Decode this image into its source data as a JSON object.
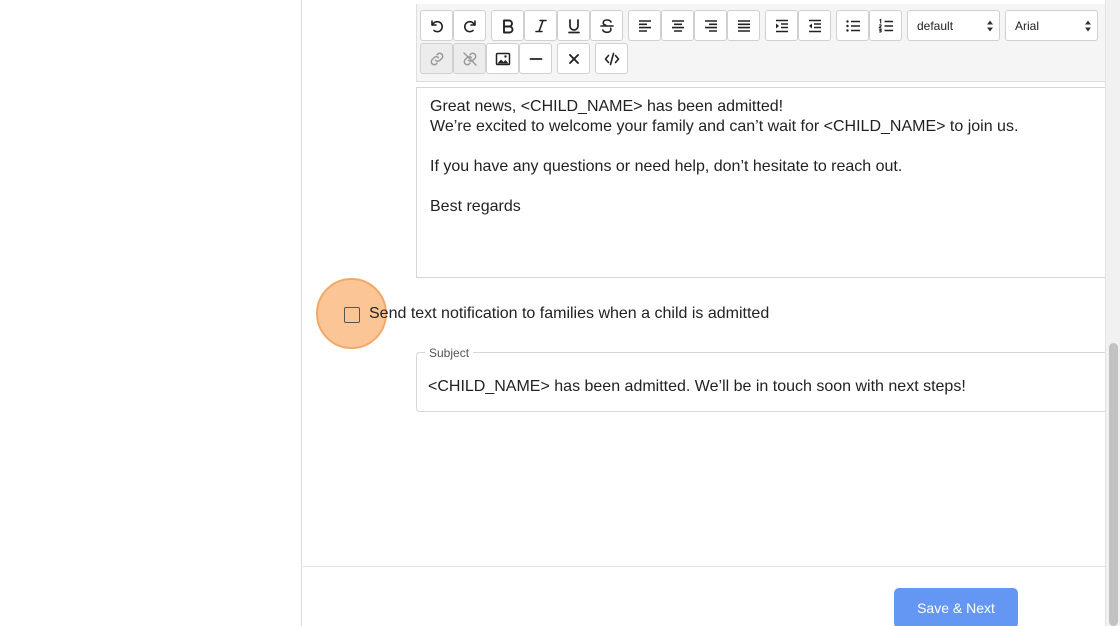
{
  "toolbar": {
    "paragraph_style": "default",
    "font_family": "Arial",
    "icons": [
      "undo-icon",
      "redo-icon",
      "bold-icon",
      "italic-icon",
      "underline-icon",
      "strikethrough-icon",
      "align-left-icon",
      "align-center-icon",
      "align-right-icon",
      "align-justify-icon",
      "indent-icon",
      "outdent-icon",
      "bullet-list-icon",
      "numbered-list-icon",
      "link-icon",
      "unlink-icon",
      "image-icon",
      "horizontal-rule-icon",
      "clear-format-icon",
      "code-view-icon"
    ]
  },
  "editor": {
    "lines": [
      "Great news, <CHILD_NAME> has been admitted!",
      "We’re excited to welcome your family and can’t wait for <CHILD_NAME> to join us.",
      "",
      "If you have any questions or need help, don’t hesitate to reach out.",
      "",
      "Best regards"
    ]
  },
  "sms_notification": {
    "label": "Send text notification to families when a child is admitted",
    "checked": false
  },
  "subject": {
    "label": "Subject",
    "value": "<CHILD_NAME> has been admitted. We’ll be in touch soon with next steps!"
  },
  "footer": {
    "save_label": "Save & Next"
  },
  "colors": {
    "primary_button": "#6497f3",
    "highlight": "#f6a868"
  }
}
